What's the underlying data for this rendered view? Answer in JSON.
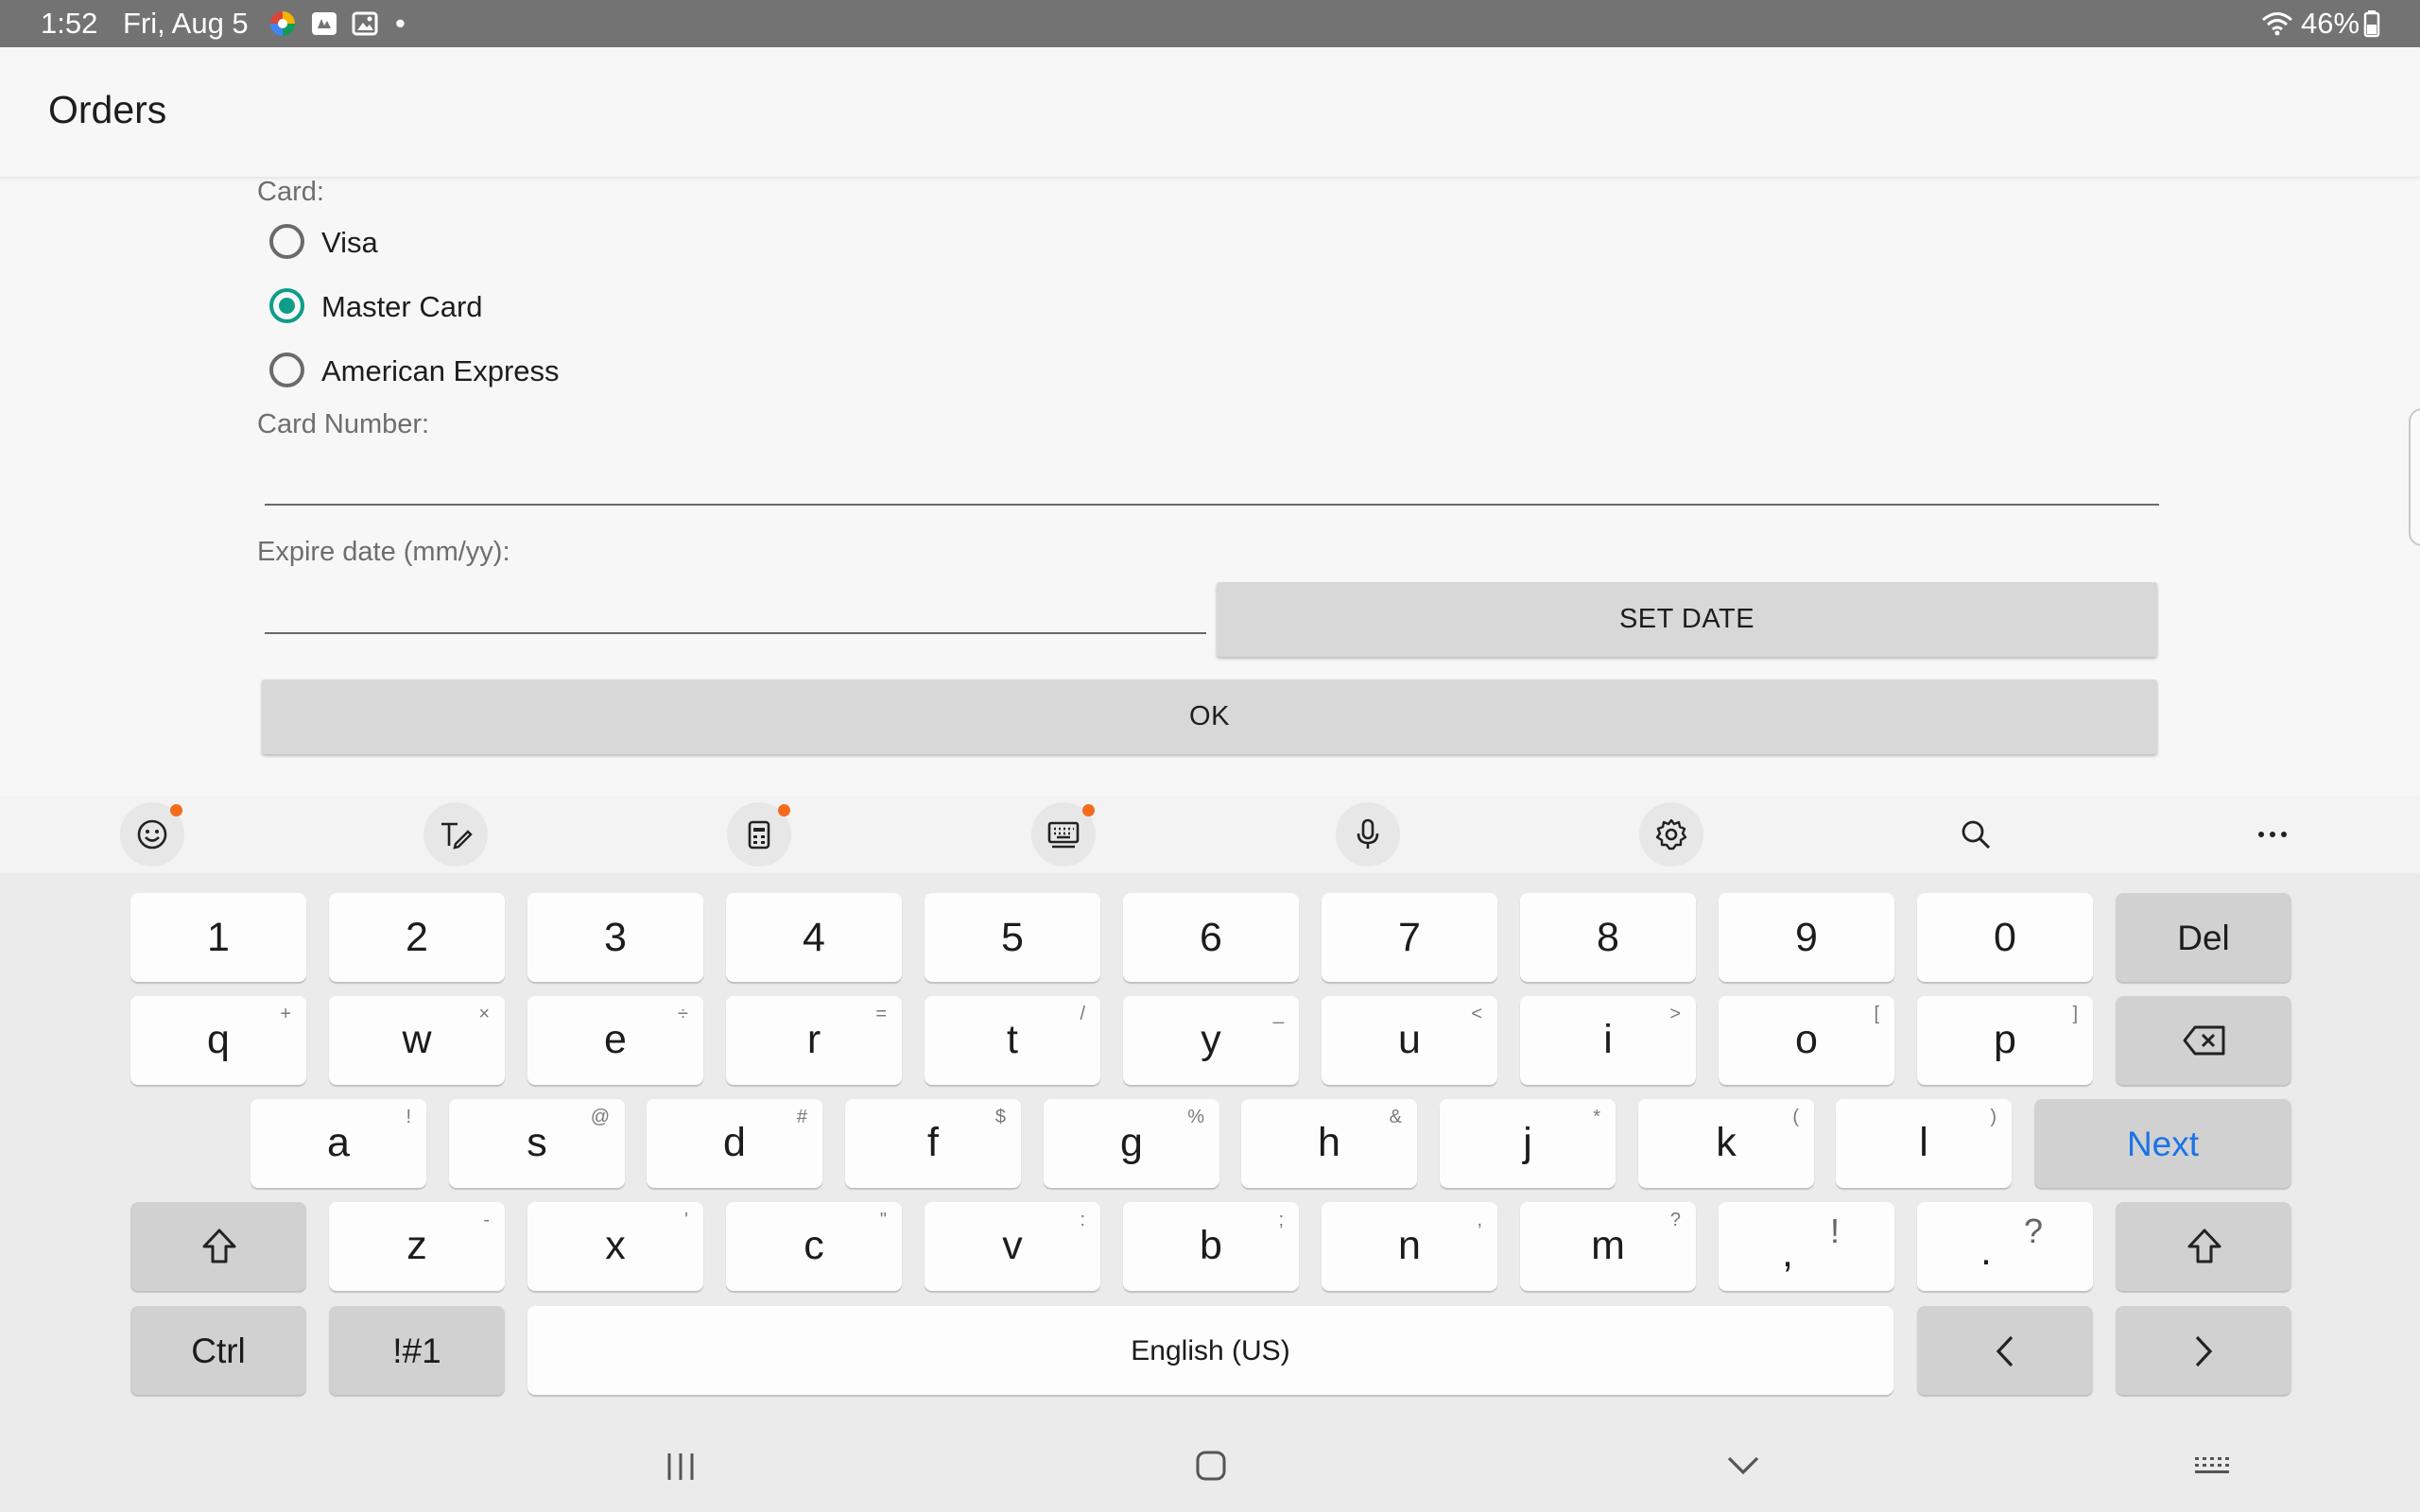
{
  "status_bar": {
    "time": "1:52",
    "date": "Fri, Aug 5",
    "dot": "•",
    "battery": "46%",
    "icons": [
      "app-icon-colorful",
      "app-icon-square",
      "gallery-icon",
      "wifi-icon",
      "battery-icon"
    ]
  },
  "app_bar": {
    "title": "Orders"
  },
  "form": {
    "card_label": "Card:",
    "options": [
      {
        "label": "Visa",
        "checked": false
      },
      {
        "label": "Master Card",
        "checked": true
      },
      {
        "label": "American Express",
        "checked": false
      }
    ],
    "card_number_label": "Card Number:",
    "card_number_value": "",
    "expire_label": "Expire date (mm/yy):",
    "expire_value": "",
    "set_date_button": "SET DATE",
    "ok_button": "OK",
    "accent_color": "#0f9d8a"
  },
  "keyboard": {
    "toolbar_icons": [
      "emoji-icon",
      "handwriting-icon",
      "clipboard-icon",
      "keyboard-layout-icon",
      "microphone-icon",
      "settings-icon",
      "search-icon",
      "more-icon"
    ],
    "number_row": [
      "1",
      "2",
      "3",
      "4",
      "5",
      "6",
      "7",
      "8",
      "9",
      "0"
    ],
    "del_label": "Del",
    "row_q": [
      {
        "k": "q",
        "s": "+"
      },
      {
        "k": "w",
        "s": "×"
      },
      {
        "k": "e",
        "s": "÷"
      },
      {
        "k": "r",
        "s": "="
      },
      {
        "k": "t",
        "s": "/"
      },
      {
        "k": "y",
        "s": "_"
      },
      {
        "k": "u",
        "s": "<"
      },
      {
        "k": "i",
        "s": ">"
      },
      {
        "k": "o",
        "s": "["
      },
      {
        "k": "p",
        "s": "]"
      }
    ],
    "row_a": [
      {
        "k": "a",
        "s": "!"
      },
      {
        "k": "s",
        "s": "@"
      },
      {
        "k": "d",
        "s": "#"
      },
      {
        "k": "f",
        "s": "$"
      },
      {
        "k": "g",
        "s": "%"
      },
      {
        "k": "h",
        "s": "&"
      },
      {
        "k": "j",
        "s": "*"
      },
      {
        "k": "k",
        "s": "("
      },
      {
        "k": "l",
        "s": ")"
      }
    ],
    "next_label": "Next",
    "next_color": "#1a73e8",
    "row_z": [
      {
        "k": "z",
        "s": "-"
      },
      {
        "k": "x",
        "s": "'"
      },
      {
        "k": "c",
        "s": "\""
      },
      {
        "k": "v",
        "s": ":"
      },
      {
        "k": "b",
        "s": ";"
      },
      {
        "k": "n",
        "s": ","
      },
      {
        "k": "m",
        "s": "?"
      }
    ],
    "comma_key": {
      "k": ",",
      "s": "!"
    },
    "period_key": {
      "k": ".",
      "s": "?"
    },
    "ctrl_label": "Ctrl",
    "symbols_label": "!#1",
    "space_label": "English (US)"
  },
  "nav_bar": {
    "icons": [
      "recent-apps-icon",
      "home-icon",
      "back-icon",
      "keyboard-hide-icon"
    ]
  }
}
